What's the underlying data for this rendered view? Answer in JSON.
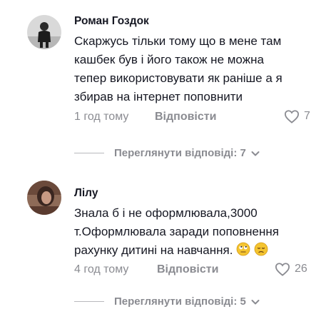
{
  "comments": [
    {
      "author": "Роман Гоздок",
      "lines": [
        "Скаржусь тільки тому що в мене там",
        "кашбек був і його також не можна",
        "тепер використовувати як раніше а я",
        "збирав на інтернет поповнити"
      ],
      "time": "1 год тому",
      "reply_label": "Відповісти",
      "likes": "7",
      "view_replies": "Переглянути відповіді: 7"
    },
    {
      "author": "Лілу",
      "lines": [
        "Знала б і не оформлювала,3000",
        "т.Оформлювала заради поповнення",
        "рахунку дитині на навчання."
      ],
      "time": "4 год тому",
      "reply_label": "Відповісти",
      "likes": "26",
      "view_replies": "Переглянути відповіді: 5"
    }
  ],
  "colors": {
    "text": "#161823",
    "meta": "#8a8b91",
    "divider": "#b8b9bd"
  },
  "icons": [
    "heart-icon",
    "chevron-down-icon",
    "rolling-eyes-emoji",
    "disappointed-face-emoji"
  ]
}
